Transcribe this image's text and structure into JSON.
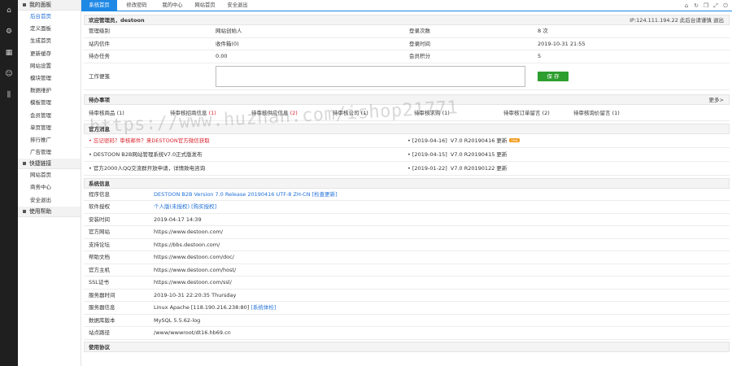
{
  "header": {
    "tabs": [
      "系统首页",
      "修改密码",
      "我的中心",
      "网站首页",
      "安全退出"
    ],
    "active_tab": 0
  },
  "sidebar": {
    "groups": [
      {
        "title": "我的面板",
        "items": [
          "后台首页",
          "定义面板",
          "生成首页",
          "更新缓存",
          "网站设置",
          "模块管理",
          "数据维护",
          "模板管理",
          "会员管理",
          "单页管理",
          "排行推广",
          "广告管理"
        ]
      },
      {
        "title": "快捷链接",
        "items": [
          "网站首页",
          "商务中心",
          "安全退出"
        ]
      },
      {
        "title": "使用帮助",
        "items": []
      }
    ]
  },
  "welcome": {
    "text": "欢迎管理员，destoon",
    "ip_info": "IP:124.111.194.22 此后台请谨慎 退出"
  },
  "admin_info": {
    "rows": [
      {
        "k1": "管理级别",
        "v1": "网站创始人",
        "k2": "登录次数",
        "v2": "8 次"
      },
      {
        "k1": "站内信件",
        "v1": "收件箱(0)",
        "k2": "登录时间",
        "v2": "2019-10-31 21:55"
      },
      {
        "k1": "待办任务",
        "v1": "0.00",
        "k2": "会员积分",
        "v2": "5"
      }
    ],
    "notepad_label": "工作便笺",
    "save_label": "保 存"
  },
  "todo": {
    "title": "待办事项",
    "more": "更多>",
    "items": [
      {
        "label": "待审核商品",
        "count": "(1)"
      },
      {
        "label": "待审核招商信息",
        "count": "(1)"
      },
      {
        "label": "待审核供应信息",
        "count": "(2)"
      },
      {
        "label": "待审核公司",
        "count": "(1)"
      },
      {
        "label": "待审核求购",
        "count": "(1)"
      },
      {
        "label": "待审核订单留言",
        "count": "(2)"
      },
      {
        "label": "待审核询价留言",
        "count": "(1)"
      }
    ]
  },
  "official": {
    "title": "官方消息",
    "left": [
      "• 忘记密码？审核邮件？来DESTOON官方微信获取",
      "• DESTOON B2B网站管理系统V7.0正式版发布",
      "• 官方2000人QQ交流群开放申请，详情致电咨询"
    ],
    "right": [
      {
        "date": "• [2019-04-16]",
        "text": "V7.0 R20190416 更新",
        "badge": "new"
      },
      {
        "date": "• [2019-04-15]",
        "text": "V7.0 R20190415 更新",
        "badge": ""
      },
      {
        "date": "• [2019-01-22]",
        "text": "V7.0 R20190122 更新",
        "badge": ""
      }
    ]
  },
  "system": {
    "title": "系统信息",
    "rows": [
      {
        "k": "程序信息",
        "v": "DESTOON B2B Version 7.0 Release 20190416 UTF-8 ZH-CN [检查更新]",
        "link": true
      },
      {
        "k": "软件授权",
        "v": "个人版(未授权) [购买授权]",
        "link": true
      },
      {
        "k": "安装时间",
        "v": "2019-04-17 14:39",
        "link": false
      },
      {
        "k": "官方网站",
        "v": "https://www.destoon.com/",
        "link": false
      },
      {
        "k": "支持论坛",
        "v": "https://bbs.destoon.com/",
        "link": false
      },
      {
        "k": "帮助文档",
        "v": "https://www.destoon.com/doc/",
        "link": false
      },
      {
        "k": "官方主机",
        "v": "https://www.destoon.com/host/",
        "link": false
      },
      {
        "k": "SSL证书",
        "v": "https://www.destoon.com/ssl/",
        "link": false
      },
      {
        "k": "服务器时间",
        "v": "2019-10-31 22:20:35 Thursday",
        "link": false
      },
      {
        "k": "服务器信息",
        "v": "Linux Apache [118.190.216.238:80]",
        "extra": "[系统体检]",
        "link": false
      },
      {
        "k": "数据库版本",
        "v": "MySQL 5.5.62-log",
        "link": false
      },
      {
        "k": "站点路径",
        "v": "/www/wwwroot/dt16.hb69.cn",
        "link": false
      }
    ]
  },
  "usage": {
    "title": "使用协议"
  },
  "watermark": "https://www.huzhan.com/ishop21771",
  "colors": {
    "accent": "#1e88e5",
    "save": "#2e9e2e",
    "alert": "#d9232d",
    "rail": "#1f1f1f"
  }
}
